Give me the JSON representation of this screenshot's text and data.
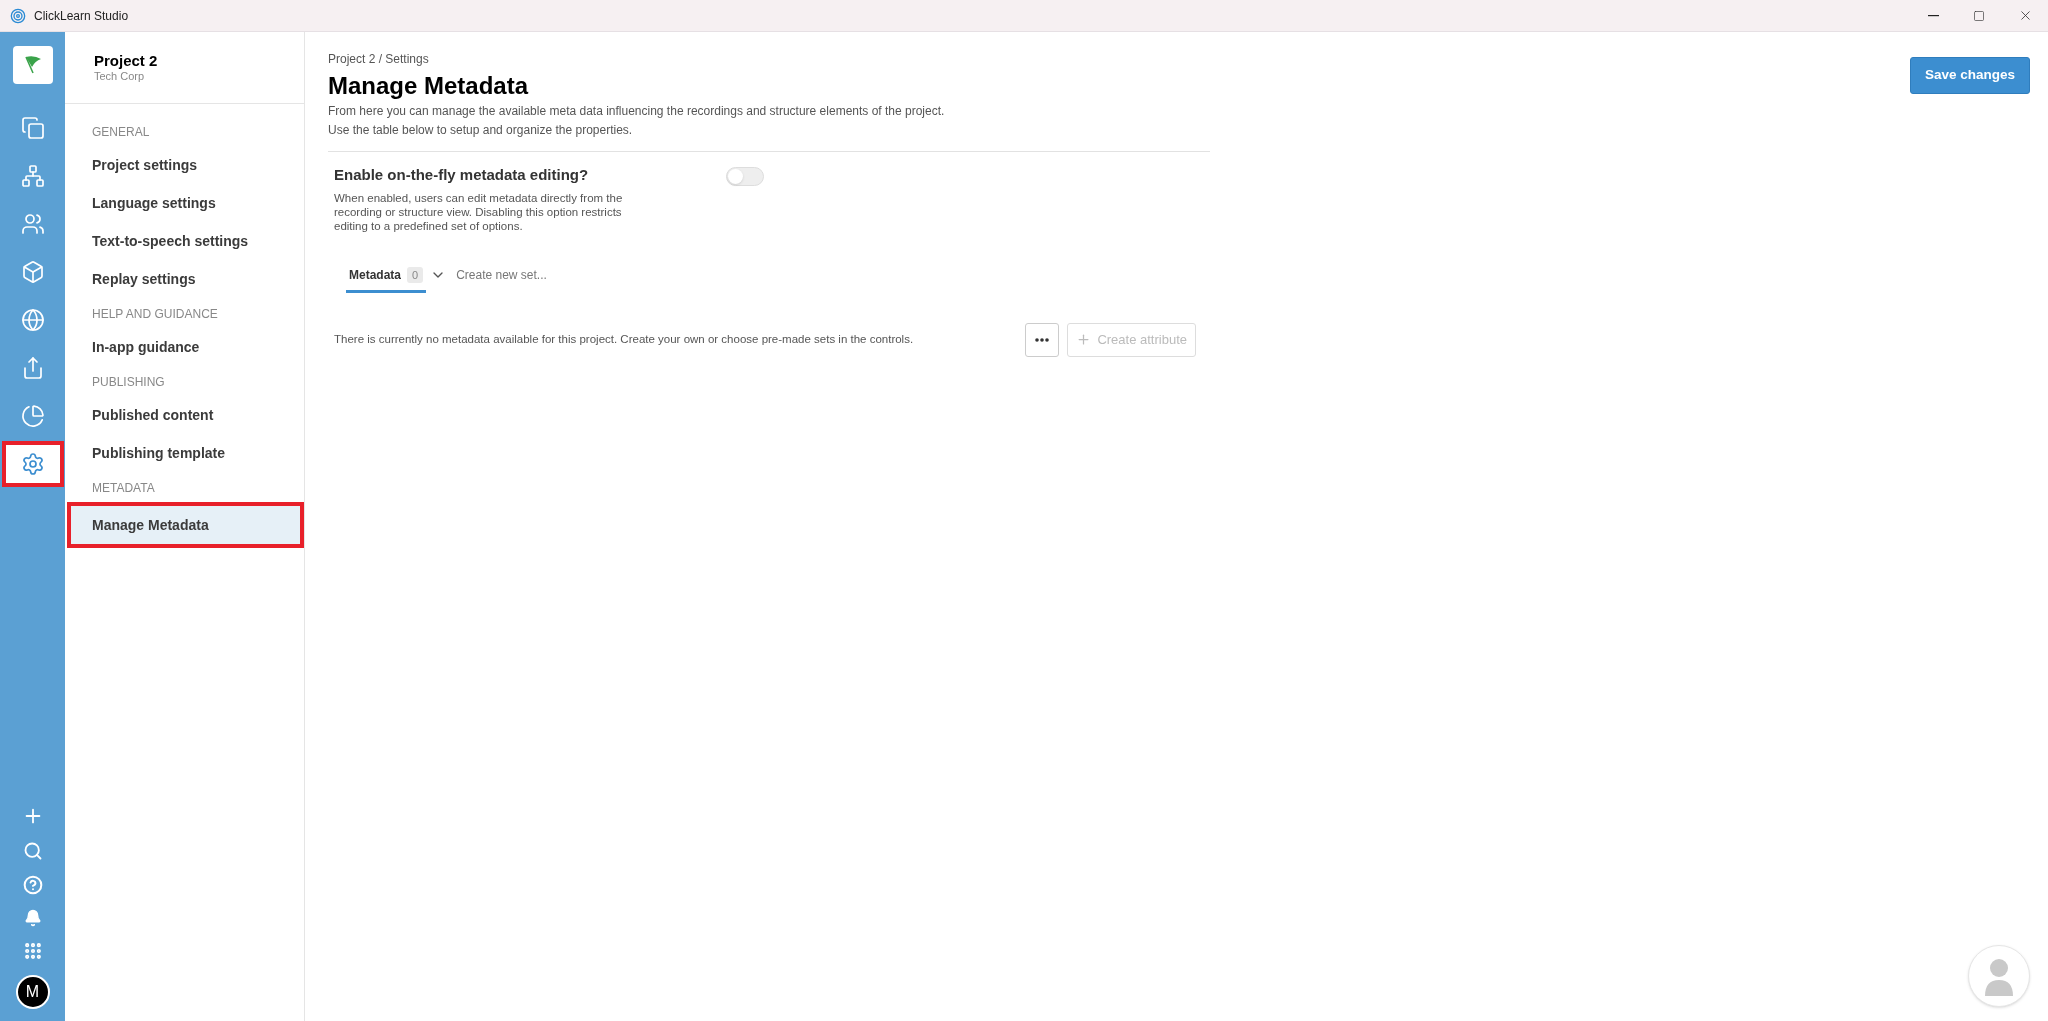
{
  "window": {
    "title": "ClickLearn Studio"
  },
  "rail": {
    "items": [
      {
        "selected": false,
        "highlighted": false
      },
      {
        "selected": false,
        "highlighted": false
      },
      {
        "selected": false,
        "highlighted": false
      },
      {
        "selected": false,
        "highlighted": false
      },
      {
        "selected": false,
        "highlighted": false
      },
      {
        "selected": false,
        "highlighted": false
      },
      {
        "selected": false,
        "highlighted": false
      },
      {
        "selected": true,
        "highlighted": true
      }
    ],
    "user_initial": "M"
  },
  "sidebar": {
    "project": "Project 2",
    "company": "Tech Corp",
    "sections": [
      {
        "heading": "GENERAL",
        "items": [
          {
            "label": "Project settings",
            "selected": false,
            "highlighted": false
          },
          {
            "label": "Language settings",
            "selected": false,
            "highlighted": false
          },
          {
            "label": "Text-to-speech settings",
            "selected": false,
            "highlighted": false
          },
          {
            "label": "Replay settings",
            "selected": false,
            "highlighted": false
          }
        ]
      },
      {
        "heading": "HELP AND GUIDANCE",
        "items": [
          {
            "label": "In-app guidance",
            "selected": false,
            "highlighted": false
          }
        ]
      },
      {
        "heading": "PUBLISHING",
        "items": [
          {
            "label": "Published content",
            "selected": false,
            "highlighted": false
          },
          {
            "label": "Publishing template",
            "selected": false,
            "highlighted": false
          }
        ]
      },
      {
        "heading": "METADATA",
        "items": [
          {
            "label": "Manage Metadata",
            "selected": true,
            "highlighted": true
          }
        ]
      }
    ]
  },
  "main": {
    "breadcrumb": "Project 2 / Settings",
    "title": "Manage Metadata",
    "description": [
      "From here you can manage the available meta data influencing the recordings and structure elements of the project.",
      "Use the table below to setup and organize the properties."
    ],
    "save_button": "Save changes",
    "toggle": {
      "label": "Enable on-the-fly metadata editing?",
      "description": "When enabled, users can edit metadata directly from the recording or structure view. Disabling this option restricts editing to a predefined set of options.",
      "on": false
    },
    "tabs": [
      {
        "label": "Metadata",
        "count": "0",
        "selected": true
      }
    ],
    "new_set": "Create new set...",
    "empty_message": "There is currently no metadata available for this project. Create your own or choose pre-made sets in the controls.",
    "create_attribute": {
      "label": "Create attribute",
      "disabled": true
    }
  }
}
